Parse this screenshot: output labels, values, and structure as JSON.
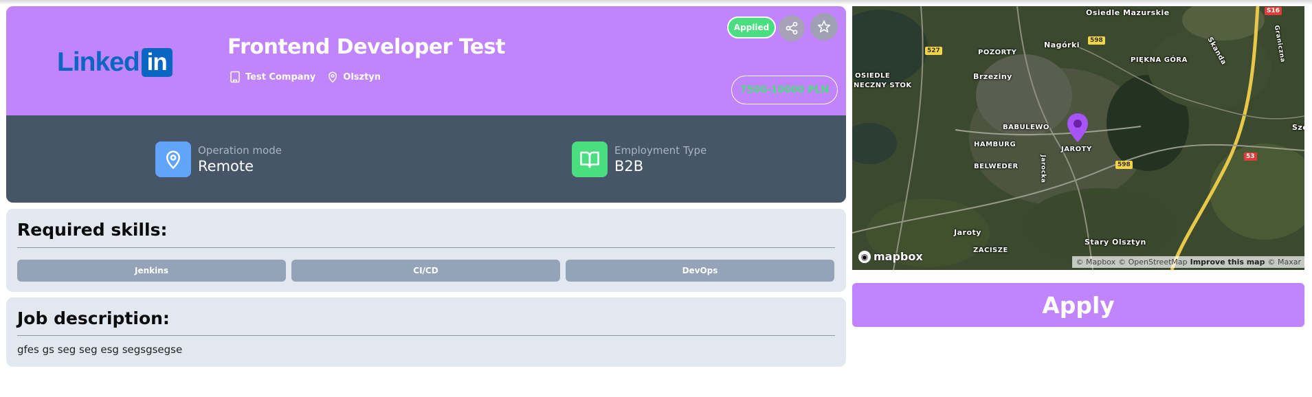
{
  "job": {
    "logo": {
      "text": "Linked",
      "box": "in"
    },
    "title": "Frontend Developer Test",
    "company": "Test Company",
    "location": "Olsztyn",
    "status_badge": "Applied",
    "salary": "7500-10000 PLN"
  },
  "info": {
    "operation_mode": {
      "label": "Operation mode",
      "value": "Remote"
    },
    "employment_type": {
      "label": "Employment Type",
      "value": "B2B"
    }
  },
  "skills": {
    "title": "Required skills:",
    "items": [
      "Jenkins",
      "CI/CD",
      "DevOps"
    ]
  },
  "description": {
    "title": "Job description:",
    "text": "gfes gs seg seg esg segsgsegse"
  },
  "map": {
    "labels": [
      "Osiedle Mazurskie",
      "Nagórki",
      "POZORTY",
      "PIĘKNA GÓRA",
      "Skanda",
      "Brzeziny",
      "OSIEDLE",
      "NECZNY STOK",
      "BABULEWO",
      "HAMBURG",
      "JAROTY",
      "BELWEDER",
      "Jarocka",
      "Jaroty",
      "ZACISZE",
      "Stary Olsztyn",
      "Graniczna",
      "Szo"
    ],
    "road_numbers": [
      "S16",
      "598",
      "527",
      "598",
      "53"
    ],
    "logo": "mapbox",
    "attribution": [
      "© Mapbox",
      "© OpenStreetMap",
      "Improve this map",
      "© Maxar"
    ]
  },
  "apply_label": "Apply",
  "colors": {
    "primary": "#c084fc",
    "success": "#4ade80",
    "slate": "#475569",
    "panel": "#e2e8f0"
  }
}
